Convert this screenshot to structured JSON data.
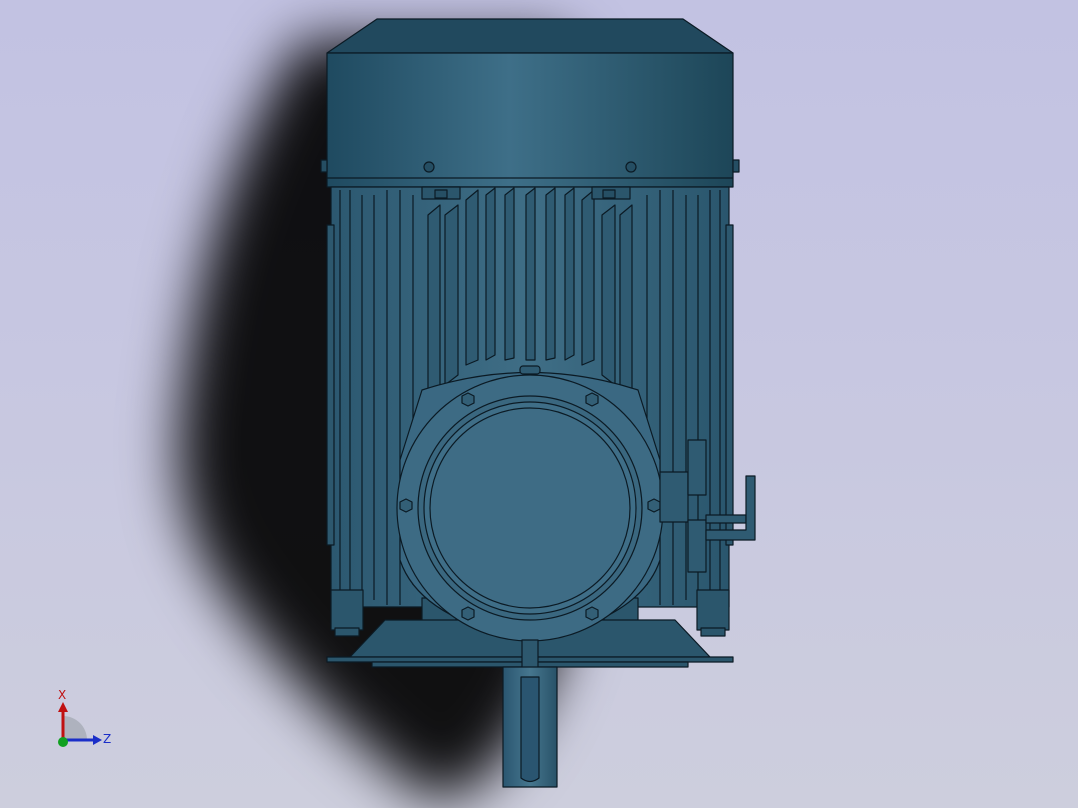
{
  "viewport": {
    "background_top": "#c2c2e2",
    "background_bottom": "#cdcedd",
    "model_color": "#3a6680",
    "edge_color": "#0b1a24"
  },
  "model": {
    "name": "",
    "icon": "electric-motor-icon"
  },
  "triad": {
    "x_label": "X",
    "z_label": "Z",
    "x_color": "#c01010",
    "y_color": "#10a020",
    "z_color": "#1a2ec8"
  }
}
